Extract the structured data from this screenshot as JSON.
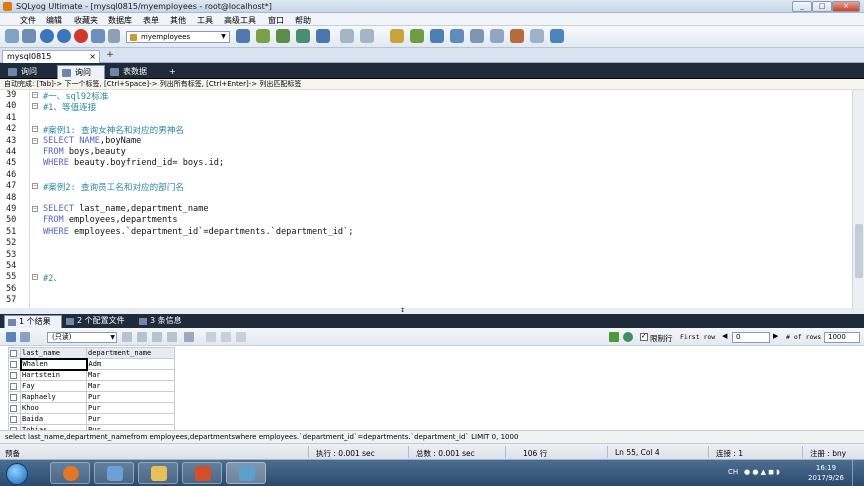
{
  "window": {
    "title": "SQLyog Ultimate - [mysql0815/myemployees - root@localhost*]",
    "controls": [
      "_",
      "□",
      "×"
    ]
  },
  "menu": [
    "文件",
    "编辑",
    "收藏夹",
    "数据库",
    "表单",
    "其他",
    "工具",
    "高级工具",
    "窗口",
    "帮助"
  ],
  "toolbar": {
    "database_select": "myemployees"
  },
  "connection_tab": {
    "label": "mysql0815",
    "add": "+"
  },
  "query_tabs": [
    {
      "label": "询问"
    },
    {
      "label": "询问"
    },
    {
      "label": "表数据"
    }
  ],
  "query_tab_add": "+",
  "hint": "自动完成: [Tab]-> 下一个标签, [Ctrl+Space]-> 列出所有标签, [Ctrl+Enter]-> 列出匹配标签",
  "editor": {
    "line_numbers": [
      "39",
      "40",
      "41",
      "42",
      "43",
      "44",
      "45",
      "46",
      "47",
      "48",
      "49",
      "50",
      "51",
      "52",
      "53",
      "54",
      "55",
      "56",
      "57"
    ],
    "lines": [
      {
        "kind": "comment",
        "text": "#一、sql92标准"
      },
      {
        "kind": "comment",
        "text": "#1、等值连接"
      },
      {
        "kind": "blank",
        "text": ""
      },
      {
        "kind": "comment",
        "text": "#案例1: 查询女神名和对应的男神名"
      },
      {
        "kind": "code",
        "kw": "SELECT NAME",
        "text": ",boyName"
      },
      {
        "kind": "code",
        "kw": "FROM",
        "text": " boys,beauty"
      },
      {
        "kind": "code",
        "kw": "WHERE",
        "text": " beauty.boyfriend_id= boys.id;"
      },
      {
        "kind": "blank",
        "text": ""
      },
      {
        "kind": "comment",
        "text": "#案例2: 查询员工名和对应的部门名"
      },
      {
        "kind": "blank",
        "text": ""
      },
      {
        "kind": "code",
        "kw": "SELECT",
        "text": " last_name,department_name"
      },
      {
        "kind": "code",
        "kw": "FROM",
        "text": " employees,departments"
      },
      {
        "kind": "code",
        "kw": "WHERE",
        "text": " employees.`department_id`=departments.`department_id`;"
      },
      {
        "kind": "blank",
        "text": ""
      },
      {
        "kind": "blank",
        "text": ""
      },
      {
        "kind": "blank",
        "text": ""
      },
      {
        "kind": "comment",
        "text": "#2、"
      },
      {
        "kind": "blank",
        "text": ""
      },
      {
        "kind": "blank",
        "text": ""
      }
    ]
  },
  "result_tabs": [
    {
      "label": "1 个结果"
    },
    {
      "label": "2 个配置文件"
    },
    {
      "label": "3 条信息"
    }
  ],
  "result_toolbar": {
    "mode_select": "(只读)",
    "limit_label": "限制行",
    "first_row_label": "First row",
    "first_row_value": "0",
    "rows_label": "# of rows",
    "rows_value": "1000"
  },
  "grid": {
    "columns": [
      "last_name",
      "department_name"
    ],
    "rows": [
      [
        "Whalen",
        "Adm"
      ],
      [
        "Hartstein",
        "Mar"
      ],
      [
        "Fay",
        "Mar"
      ],
      [
        "Raphaely",
        "Pur"
      ],
      [
        "Khoo",
        "Pur"
      ],
      [
        "Baida",
        "Pur"
      ],
      [
        "Tobias",
        "Pur"
      ]
    ]
  },
  "executed_sql": "select last_name,department_namefrom employees,departmentswhere employees.`department_id`=departments.`department_id` LIMIT 0, 1000",
  "status": {
    "left": "预备",
    "exec": "执行 : 0.001 sec",
    "total": "总数 : 0.001 sec",
    "bytes": "106 行",
    "position": "Ln 55, Col 4",
    "connections": "连接 : 1",
    "registered": "注册 : bny"
  },
  "taskbar": {
    "lang": "CH",
    "time": "16:19",
    "date": "2017/9/26"
  }
}
